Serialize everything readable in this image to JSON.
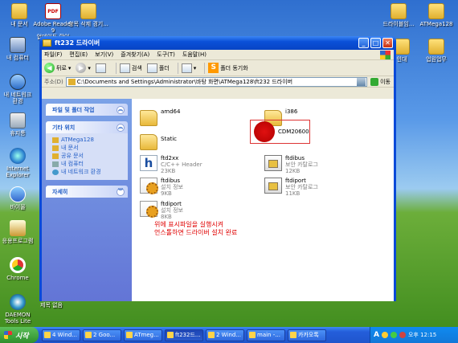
{
  "desktop": {
    "icons": [
      {
        "label": "내 문서"
      },
      {
        "label": "Adobe Reader 9\n업데이트 확인 C..."
      },
      {
        "label": "항목 삭제 경기..."
      },
      {
        "label": "내 컴퓨터"
      },
      {
        "label": "내 네트워크\n환경"
      },
      {
        "label": "휴지통"
      },
      {
        "label": "Internet\nExplorer"
      },
      {
        "label": "바이올"
      },
      {
        "label": "응용프로그램"
      },
      {
        "label": "Chrome"
      },
      {
        "label": "DAEMON\nTools Lite"
      },
      {
        "label": "제목 없음"
      },
      {
        "label": "드라이블임..."
      },
      {
        "label": "ATMega128"
      },
      {
        "label": "인대"
      },
      {
        "label": "업원업무"
      }
    ]
  },
  "window": {
    "title": "ft232 드라이버",
    "controls": {
      "min": "_",
      "max": "□",
      "close": "✕"
    },
    "menu": [
      "파일(F)",
      "편집(E)",
      "보기(V)",
      "즐겨찾기(A)",
      "도구(T)",
      "도움말(H)"
    ],
    "toolbar": {
      "back": "뒤로",
      "search": "검색",
      "folders": "폴더",
      "sync": "폴더 동기화"
    },
    "address": {
      "label": "주소(D)",
      "value": "C:\\Documents and Settings\\Administrator\\바탕 화면\\ATMega128\\ft232 드라이버",
      "go": "이동"
    },
    "tasks_panels": [
      {
        "title": "파일 및 폴더 작업",
        "items": []
      },
      {
        "title": "기타 위치",
        "items": [
          "ATMega128",
          "내 문서",
          "공유 문서",
          "내 컴퓨터",
          "내 네트워크 환경"
        ]
      },
      {
        "title": "자세히",
        "items": []
      }
    ],
    "files": [
      {
        "name": "amd64",
        "sub1": "",
        "sub2": "",
        "type": "folder"
      },
      {
        "name": "i386",
        "sub1": "",
        "sub2": "",
        "type": "folder"
      },
      {
        "name": "Static",
        "sub1": "",
        "sub2": "",
        "type": "folder"
      },
      {
        "name": "CDM20600",
        "sub1": "",
        "sub2": "",
        "type": "app"
      },
      {
        "name": "ftd2xx",
        "sub1": "C/C++ Header",
        "sub2": "23KB",
        "type": "header"
      },
      {
        "name": "ftdibus",
        "sub1": "보안 카탈로그",
        "sub2": "12KB",
        "type": "catalog"
      },
      {
        "name": "ftdibus",
        "sub1": "설치 정보",
        "sub2": "9KB",
        "type": "setup"
      },
      {
        "name": "ftdiport",
        "sub1": "보안 카탈로그",
        "sub2": "11KB",
        "type": "catalog"
      },
      {
        "name": "ftdiport",
        "sub1": "설치 정보",
        "sub2": "8KB",
        "type": "setup"
      }
    ],
    "note": [
      "위에 표시파일을 실행시켜",
      "언스톨하면 드라이버 설치 완료"
    ]
  },
  "taskbar": {
    "start": "시작",
    "tasks": [
      "4 Wind...",
      "2 Goo...",
      "ATmeg...",
      "ft232드...",
      "2 Wind...",
      "main -...",
      "카카오톡"
    ],
    "tray": {
      "lang": "A",
      "time": "오후 12:15"
    }
  }
}
